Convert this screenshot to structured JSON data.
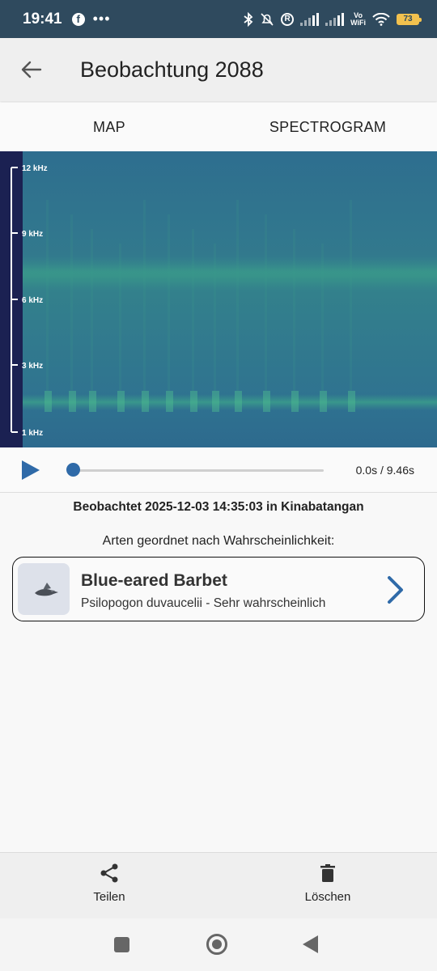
{
  "status_bar": {
    "time": "19:41",
    "dots": "•••",
    "vo_label": "Vo",
    "wifi_label": "WiFi",
    "battery": "73",
    "r_badge": "R"
  },
  "app_bar": {
    "title": "Beobachtung 2088"
  },
  "tabs": [
    {
      "label": "MAP"
    },
    {
      "label": "SPECTROGRAM"
    }
  ],
  "spectrogram": {
    "axis_labels": [
      "12 kHz",
      "9 kHz",
      "6 kHz",
      "3 kHz",
      "1 kHz"
    ],
    "colors": {
      "axis_bg": "#1b2152",
      "low": "#2f6e8e",
      "high": "#3fa78a"
    }
  },
  "player": {
    "time": "0.0s / 9.46s",
    "progress": 0.0
  },
  "observation": {
    "observed_text": "Beobachtet 2025-12-03 14:35:03 in Kinabatangan",
    "species_heading": "Arten geordnet nach Wahrscheinlichkeit:"
  },
  "species": [
    {
      "common_name": "Blue-eared Barbet",
      "scientific_line": "Psilopogon duvaucelii - Sehr wahrscheinlich"
    }
  ],
  "actions": {
    "share_label": "Teilen",
    "delete_label": "Löschen"
  },
  "colors": {
    "accent": "#2f6aa8",
    "status_bar": "#2f4a5e"
  }
}
